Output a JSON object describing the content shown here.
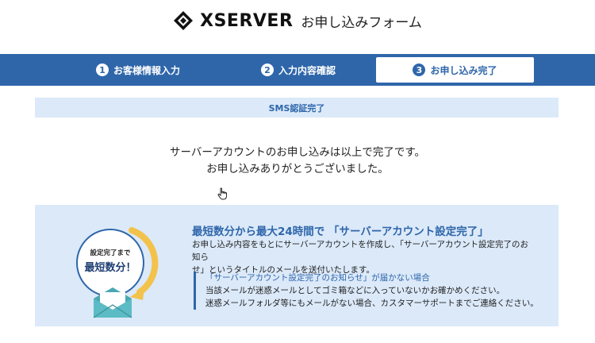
{
  "brand": {
    "logo_icon": "xserver-diamond-logo",
    "name": "XSERVER",
    "form_title": "お申し込みフォーム"
  },
  "steps": [
    {
      "number": "1",
      "label": "お客様情報入力",
      "state": "done"
    },
    {
      "number": "2",
      "label": "入力内容確認",
      "state": "done"
    },
    {
      "number": "3",
      "label": "お申し込み完了",
      "state": "current"
    }
  ],
  "sms_status": "SMS認証完了",
  "complete_message": {
    "line1": "サーバーアカウントのお申し込みは以上で完了です。",
    "line2": "お申し込みありがとうございました。"
  },
  "info": {
    "badge_small": "設定完了まで",
    "badge_big": "最短数分！",
    "title": "最短数分から最大24時間で 「サーバーアカウント設定完了」",
    "desc_line1": "お申し込み内容をもとにサーバーアカウントを作成し、「サーバーアカウント設定完了のお知ら",
    "desc_line2": "せ」というタイトルのメールを送付いたします。",
    "notice_title": "「サーバーアカウント設定完了のお知らせ」が届かない場合",
    "notice_line1": "当該メールが迷惑メールとしてゴミ箱などに入っていないかお確かめください。",
    "notice_line2": "迷惑メールフォルダ等にもメールがない場合、カスタマーサポートまでご連絡ください。"
  },
  "colors": {
    "primary": "#2f66aa",
    "light_band": "#dbe9f9",
    "badge_arc": "#f3c24a",
    "envelope": "#4aa7b3"
  }
}
